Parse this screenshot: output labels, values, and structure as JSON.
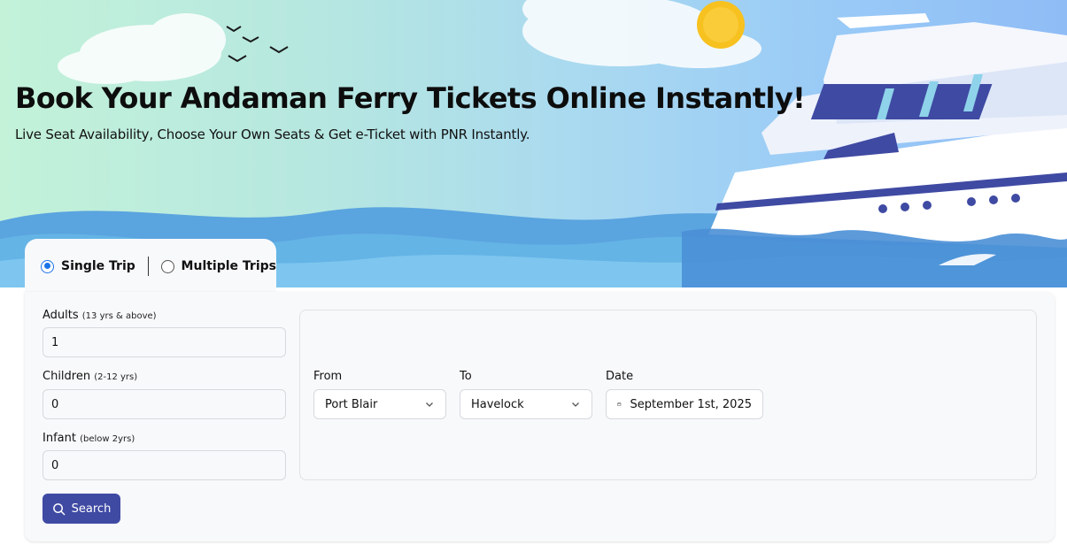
{
  "hero": {
    "title": "Book Your Andaman Ferry Tickets Online Instantly!",
    "subtitle": "Live Seat Availability, Choose Your Own Seats & Get e-Ticket with PNR Instantly."
  },
  "trip_type": {
    "options": [
      {
        "label": "Single Trip",
        "selected": true
      },
      {
        "label": "Multiple Trips",
        "selected": false
      }
    ]
  },
  "passengers": {
    "adults": {
      "label": "Adults",
      "hint": "(13 yrs & above)",
      "value": "1"
    },
    "children": {
      "label": "Children",
      "hint": "(2-12 yrs)",
      "value": "0"
    },
    "infant": {
      "label": "Infant",
      "hint": "(below 2yrs)",
      "value": "0"
    }
  },
  "route": {
    "from": {
      "label": "From",
      "value": "Port Blair"
    },
    "to": {
      "label": "To",
      "value": "Havelock"
    },
    "date": {
      "label": "Date",
      "value": "September 1st, 2025"
    }
  },
  "search": {
    "label": "Search"
  },
  "colors": {
    "primary_button": "#3f4aa3",
    "radio_accent": "#1a73e8",
    "wave_blue": "#4f9fe0"
  },
  "icons": [
    "search-icon",
    "calendar-icon",
    "chevron-down-icon"
  ]
}
